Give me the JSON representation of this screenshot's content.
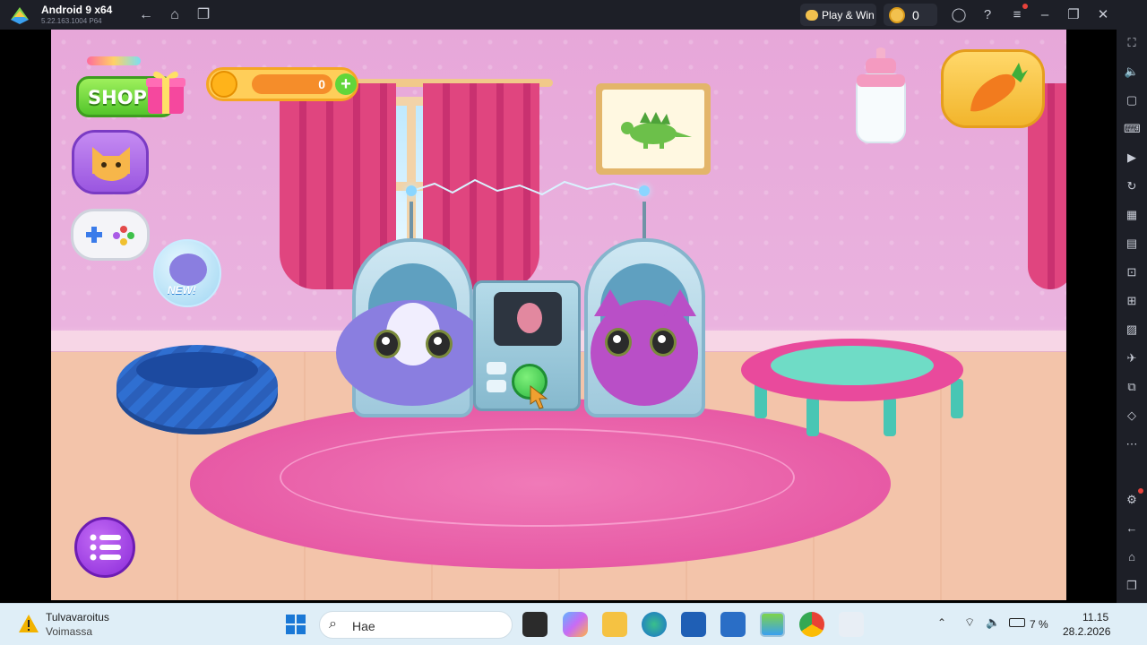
{
  "emulator": {
    "title": "Android 9 x64",
    "version": "5.22.163.1004  P64",
    "play_win_label": "Play & Win",
    "coin_count": "0"
  },
  "game": {
    "shop_label": "SHOP",
    "coins": "0",
    "new_badge": "NEW!",
    "colors": {
      "wall": "#e7a7d9",
      "rug": "#e75aa5",
      "floor": "#f3c4aa",
      "shop": "#53c52b",
      "menu": "#8a2ad9"
    }
  },
  "taskbar": {
    "weather_title": "Tulvavaroitus",
    "weather_subtitle": "Voimassa",
    "search_placeholder": "Hae",
    "battery": "7 %",
    "time": "11.15",
    "date": "28.2.2026"
  }
}
